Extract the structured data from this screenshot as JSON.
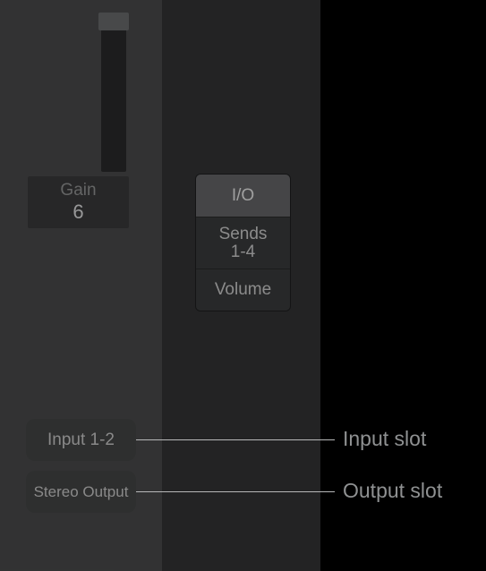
{
  "gain": {
    "label": "Gain",
    "value": "6"
  },
  "menu": {
    "items": [
      {
        "label": "I/O",
        "selected": true
      },
      {
        "label": "Sends\n1-4",
        "selected": false
      },
      {
        "label": "Volume",
        "selected": false
      }
    ]
  },
  "io": {
    "input_label": "Input 1-2",
    "output_label": "Stereo Output"
  },
  "callouts": {
    "input": "Input slot",
    "output": "Output slot"
  }
}
